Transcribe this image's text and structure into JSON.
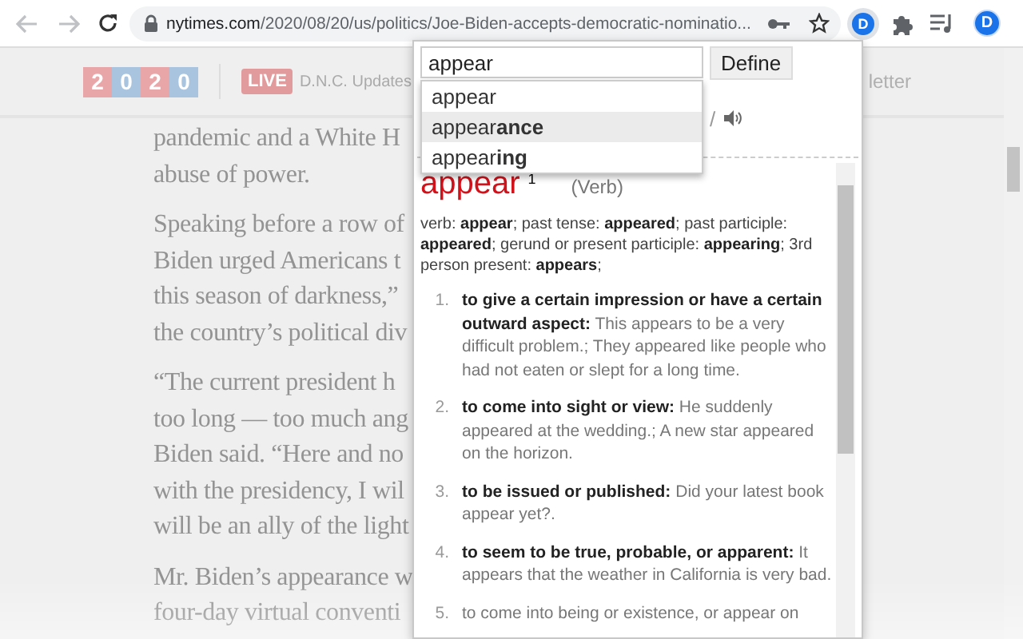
{
  "browser": {
    "url_host": "nytimes.com",
    "url_path": "/2020/08/20/us/politics/Joe-Biden-accepts-democratic-nominatio...",
    "extension_letter": "D",
    "profile_initial": "D"
  },
  "page": {
    "logo_digits": [
      {
        "digit": "2",
        "color": "#e9a6a8"
      },
      {
        "digit": "0",
        "color": "#a9c4df"
      },
      {
        "digit": "2",
        "color": "#e9a6a8"
      },
      {
        "digit": "0",
        "color": "#a9c4df"
      }
    ],
    "live_badge": "LIVE",
    "live_label": "D.N.C. Updates",
    "header_link": "letter",
    "paragraphs": [
      {
        "lines": [
          "pandemic and a White H",
          "abuse of power."
        ]
      },
      {
        "lines": [
          "Speaking before a row of",
          "Biden urged Americans t",
          "this season of darkness,”",
          "the country’s political div"
        ]
      },
      {
        "lines": [
          "“The current president h",
          "too long — too much ang",
          "Biden said. “Here and no",
          "with the presidency, I wil",
          "will be an ally of the light"
        ]
      },
      {
        "lines": [
          "Mr. Biden’s appearance w",
          "four-day virtual conventi"
        ]
      }
    ]
  },
  "popup": {
    "search": {
      "value": "appear"
    },
    "define_button": "Define",
    "suggestions": [
      {
        "text": "appear",
        "selected": false
      },
      {
        "text": "appear**ance**",
        "selected": true
      },
      {
        "text": "appear**ing**",
        "selected": false
      }
    ],
    "pronunciation_tail": "/",
    "entry": {
      "headword": "appear",
      "sense_number": "1",
      "part_of_speech": "(Verb)",
      "forms": "verb: **appear**; past tense: **appeared**; past participle: **appeared**; gerund or present participle: **appearing**; 3rd person present: **appears**;",
      "senses": [
        {
          "number": "1.",
          "text": "**to give a certain impression or have a certain outward aspect:** This appears to be a very difficult problem.; They appeared like people who had not eaten or slept for a long time."
        },
        {
          "number": "2.",
          "text": "**to come into sight or view:** He suddenly appeared at the wedding.; A new star appeared on the horizon."
        },
        {
          "number": "3.",
          "text": "**to be issued or published:** Did your latest book appear yet?."
        },
        {
          "number": "4.",
          "text": "**to seem to be true, probable, or apparent:** It appears that the weather in California is very bad."
        },
        {
          "number": "5.",
          "text": "to come into being or existence, or appear on"
        }
      ]
    }
  }
}
